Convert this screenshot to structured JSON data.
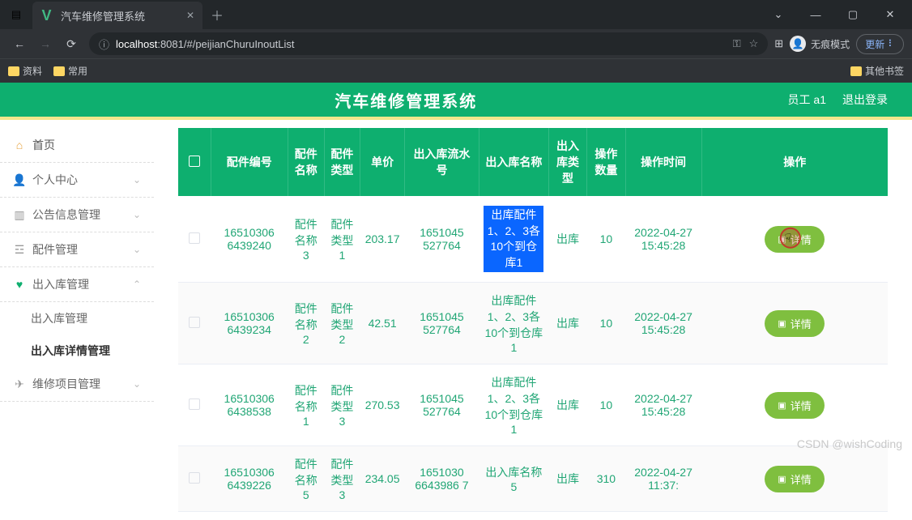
{
  "browser": {
    "tab_title": "汽车维修管理系统",
    "url_info_icon": "ⓘ",
    "url_host": "localhost",
    "url_port": ":8081",
    "url_path": "/#/peijianChuruInoutList",
    "update_label": "更新",
    "incognito_label": "无痕模式",
    "key_icon_label": "⚿",
    "bookmarks": [
      "资料",
      "常用"
    ],
    "other_bookmarks": "其他书签"
  },
  "header": {
    "title": "汽车维修管理系统",
    "user_label": "员工 a1",
    "logout_label": "退出登录"
  },
  "sidebar": {
    "home": "首页",
    "items": [
      {
        "label": "个人中心",
        "icon": "user"
      },
      {
        "label": "公告信息管理",
        "icon": "chart"
      },
      {
        "label": "配件管理",
        "icon": "settings"
      },
      {
        "label": "出入库管理",
        "icon": "bulb",
        "open": true,
        "children": [
          "出入库管理",
          "出入库详情管理"
        ]
      },
      {
        "label": "维修项目管理",
        "icon": "send"
      }
    ]
  },
  "table": {
    "columns": [
      "",
      "配件编号",
      "配件名称",
      "配件类型",
      "单价",
      "出入库流水号",
      "出入库名称",
      "出入库类型",
      "操作数量",
      "操作时间",
      "操作"
    ],
    "detail_btn_label": "详情",
    "rows": [
      {
        "no": "16510306 6439240",
        "name": "配件名称3",
        "type": "配件类型1",
        "price": "203.17",
        "serial": "1651045 527764",
        "io_name": "出库配件1、2、3各10个到仓库1",
        "io_type": "出库",
        "qty": "10",
        "time": "2022-04-27 15:45:28",
        "highlight": true
      },
      {
        "no": "16510306 6439234",
        "name": "配件名称2",
        "type": "配件类型2",
        "price": "42.51",
        "serial": "1651045 527764",
        "io_name": "出库配件1、2、3各10个到仓库1",
        "io_type": "出库",
        "qty": "10",
        "time": "2022-04-27 15:45:28"
      },
      {
        "no": "16510306 6438538",
        "name": "配件名称1",
        "type": "配件类型3",
        "price": "270.53",
        "serial": "1651045 527764",
        "io_name": "出库配件1、2、3各10个到仓库1",
        "io_type": "出库",
        "qty": "10",
        "time": "2022-04-27 15:45:28"
      },
      {
        "no": "16510306 6439226",
        "name": "配件名称5",
        "type": "配件类型3",
        "price": "234.05",
        "serial": "1651030 6643986 7",
        "io_name": "出入库名称5",
        "io_type": "出库",
        "qty": "310",
        "time": "2022-04-27 11:37:"
      }
    ]
  },
  "watermark": "CSDN @wishCoding"
}
